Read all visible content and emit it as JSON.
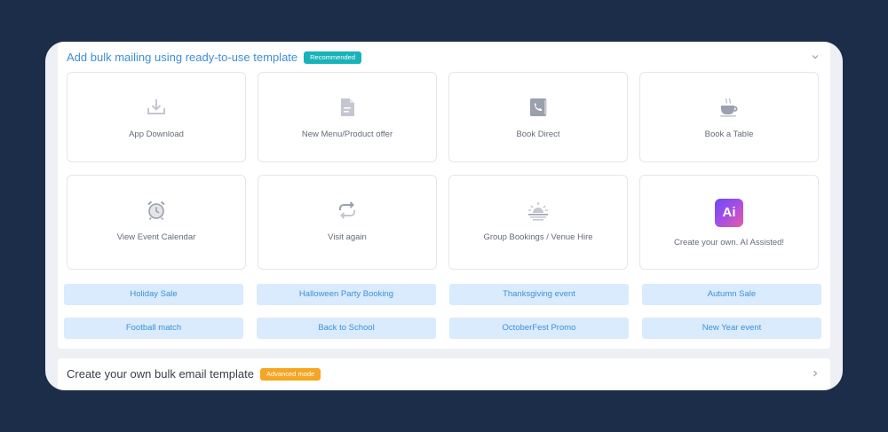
{
  "templates_section": {
    "title": "Add bulk mailing using ready-to-use template",
    "badge": "Recommended",
    "cards": [
      {
        "label": "App Download",
        "icon": "download-icon"
      },
      {
        "label": "New Menu/Product offer",
        "icon": "document-icon"
      },
      {
        "label": "Book Direct",
        "icon": "phone-book-icon"
      },
      {
        "label": "Book a Table",
        "icon": "coffee-cup-icon"
      },
      {
        "label": "View Event Calendar",
        "icon": "alarm-clock-icon"
      },
      {
        "label": "Visit again",
        "icon": "repeat-icon"
      },
      {
        "label": "Group Bookings / Venue Hire",
        "icon": "sunrise-icon"
      },
      {
        "label": "Create your own. AI Assisted!",
        "icon": "ai-icon",
        "logo_text": "Ai"
      }
    ],
    "chips": [
      "Holiday Sale",
      "Halloween Party Booking",
      "Thanksgiving event",
      "Autumn Sale",
      "Football match",
      "Back to School",
      "OctoberFest Promo",
      "New Year event"
    ]
  },
  "custom_section": {
    "title": "Create your own bulk email template",
    "badge": "Advanced mode"
  },
  "colors": {
    "background": "#1b2d49",
    "accent_blue": "#3e8fd6",
    "chip_bg": "#d9ebfd",
    "recommended_badge": "#17b3b8",
    "advanced_badge": "#f5a623"
  }
}
